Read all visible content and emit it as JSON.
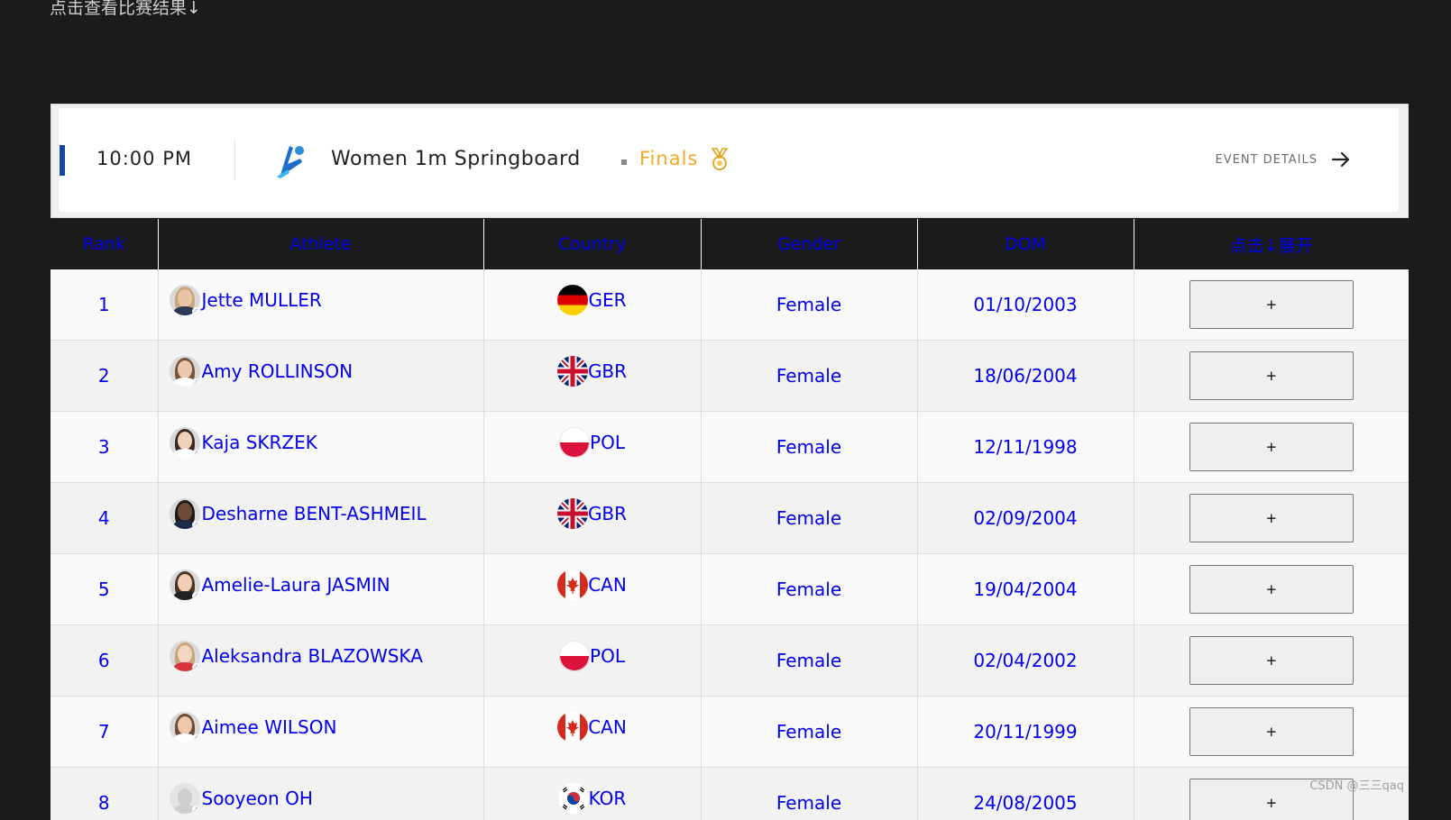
{
  "page": {
    "top_note": "点击查看比赛结果↓"
  },
  "event": {
    "time": "10:00 PM",
    "title": "Women 1m Springboard",
    "stage": "Finals",
    "details_label": "EVENT DETAILS",
    "sport_icon": "diving-icon",
    "medal_icon": "medal-icon",
    "arrow_icon": "arrow-right-icon",
    "accent_color": "#1746a2",
    "stage_color": "#f5a623"
  },
  "table": {
    "columns": [
      "Rank",
      "Athlete",
      "Country",
      "Gender",
      "DOM",
      "点击↓展开"
    ],
    "expand_label": "+",
    "link_color": "#0000ee",
    "rows": [
      {
        "rank": "1",
        "athlete": "Jette MULLER",
        "country": "GER",
        "gender": "Female",
        "dob": "01/10/2003"
      },
      {
        "rank": "2",
        "athlete": "Amy ROLLINSON",
        "country": "GBR",
        "gender": "Female",
        "dob": "18/06/2004"
      },
      {
        "rank": "3",
        "athlete": "Kaja SKRZEK",
        "country": "POL",
        "gender": "Female",
        "dob": "12/11/1998"
      },
      {
        "rank": "4",
        "athlete": "Desharne BENT-ASHMEIL",
        "country": "GBR",
        "gender": "Female",
        "dob": "02/09/2004"
      },
      {
        "rank": "5",
        "athlete": "Amelie-Laura JASMIN",
        "country": "CAN",
        "gender": "Female",
        "dob": "19/04/2004"
      },
      {
        "rank": "6",
        "athlete": "Aleksandra BLAZOWSKA",
        "country": "POL",
        "gender": "Female",
        "dob": "02/04/2002"
      },
      {
        "rank": "7",
        "athlete": "Aimee WILSON",
        "country": "CAN",
        "gender": "Female",
        "dob": "20/11/1999"
      },
      {
        "rank": "8",
        "athlete": "Sooyeon OH",
        "country": "KOR",
        "gender": "Female",
        "dob": "24/08/2005"
      }
    ]
  },
  "watermark": "CSDN @三三qaq"
}
